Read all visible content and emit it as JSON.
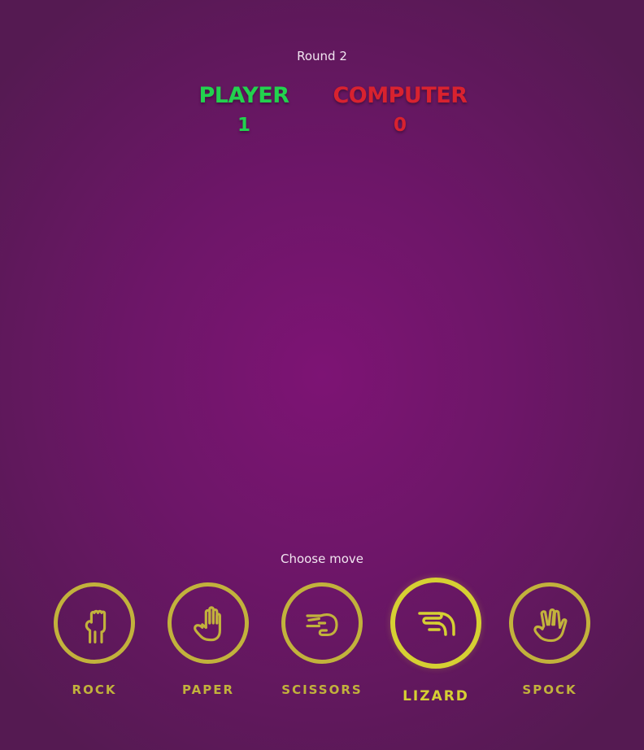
{
  "round": {
    "label": "Round 2"
  },
  "scores": {
    "player": {
      "name": "PLAYER",
      "value": "1",
      "color": "#22d24e"
    },
    "computer": {
      "name": "COMPUTER",
      "value": "0",
      "color": "#d8222f"
    }
  },
  "prompt": "Choose move",
  "moves": [
    {
      "label": "ROCK",
      "icon": "rock-hand-icon"
    },
    {
      "label": "PAPER",
      "icon": "paper-hand-icon"
    },
    {
      "label": "SCISSORS",
      "icon": "scissors-hand-icon"
    },
    {
      "label": "LIZARD",
      "icon": "lizard-hand-icon",
      "highlighted": true
    },
    {
      "label": "SPOCK",
      "icon": "spock-hand-icon"
    }
  ],
  "colors": {
    "accent": "#c2b23c",
    "accent_active": "#d6d033",
    "background": "#7d1474"
  }
}
